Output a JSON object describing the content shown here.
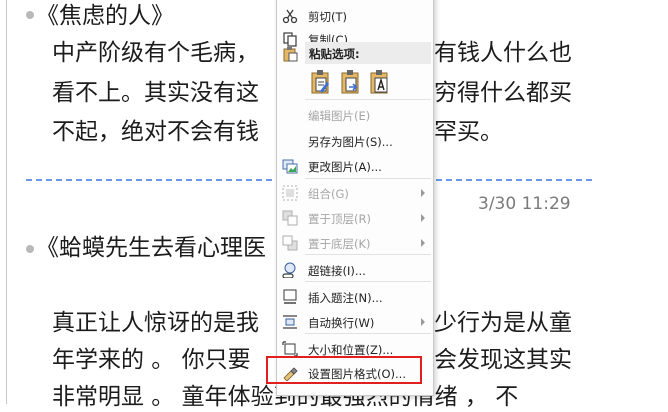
{
  "document": {
    "post1": {
      "title": "《焦虑的人》",
      "lines": [
        "中产阶级有个毛病，",
        "有钱人什么也",
        "看不上。其实没有这",
        "穷得什么都买",
        "不起，绝对不会有钱",
        "罕买。"
      ],
      "timestamp": "3/30 11:29"
    },
    "post2": {
      "title": "《蛤蟆先生去看心理医",
      "lines": [
        "真正让人惊讶的是我",
        "少行为是从童",
        "年学来的 。 你只要",
        "会发现这其实",
        "非常明显 。 童年体验到的最强烈的情绪 ，  不"
      ]
    }
  },
  "menu": {
    "items": [
      {
        "label": "剪切(T)",
        "icon": "scissors-icon",
        "enabled": true
      },
      {
        "label": "复制(C)",
        "icon": "copy-icon",
        "enabled": true
      },
      {
        "label": "粘贴选项:",
        "icon": "paste-icon",
        "enabled": true
      },
      {
        "label": "编辑图片(E)",
        "icon": "",
        "enabled": false
      },
      {
        "label": "另存为图片(S)...",
        "icon": "",
        "enabled": true
      },
      {
        "label": "更改图片(A)...",
        "icon": "change-picture-icon",
        "enabled": true
      },
      {
        "label": "组合(G)",
        "icon": "group-icon",
        "enabled": false,
        "submenu": true
      },
      {
        "label": "置于顶层(R)",
        "icon": "bring-to-front-icon",
        "enabled": false,
        "submenu": true
      },
      {
        "label": "置于底层(K)",
        "icon": "send-to-back-icon",
        "enabled": false,
        "submenu": true
      },
      {
        "label": "超链接(I)...",
        "icon": "hyperlink-icon",
        "enabled": true
      },
      {
        "label": "插入题注(N)...",
        "icon": "caption-icon",
        "enabled": true
      },
      {
        "label": "自动换行(W)",
        "icon": "wrap-text-icon",
        "enabled": true,
        "submenu": true
      },
      {
        "label": "大小和位置(Z)...",
        "icon": "size-position-icon",
        "enabled": true
      },
      {
        "label": "设置图片格式(O)...",
        "icon": "format-picture-icon",
        "enabled": true
      }
    ],
    "paste_options": [
      "keep-source-formatting-icon",
      "merge-formatting-icon",
      "keep-text-only-icon"
    ]
  },
  "colors": {
    "divider": "#6b97e6",
    "highlight_border": "#e02020",
    "text": "#1c1c1c"
  }
}
